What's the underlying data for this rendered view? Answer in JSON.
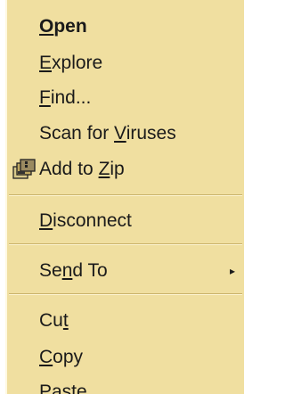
{
  "menu": {
    "open": {
      "pre": "",
      "acc": "O",
      "post": "pen"
    },
    "explore": {
      "pre": "",
      "acc": "E",
      "post": "xplore"
    },
    "find": {
      "pre": "",
      "acc": "F",
      "post": "ind..."
    },
    "scan": {
      "pre": "Scan for ",
      "acc": "V",
      "post": "iruses"
    },
    "add_zip": {
      "pre": "Add to ",
      "acc": "Z",
      "post": "ip",
      "icon": "zip-archive-icon"
    },
    "disconnect": {
      "pre": "",
      "acc": "D",
      "post": "isconnect"
    },
    "send_to": {
      "pre": "Se",
      "acc": "n",
      "post": "d To",
      "arrow": "▸"
    },
    "cut": {
      "pre": "Cu",
      "acc": "t",
      "post": ""
    },
    "copy": {
      "pre": "",
      "acc": "C",
      "post": "opy"
    },
    "paste": {
      "pre": "Paste",
      "acc": "",
      "post": ""
    }
  },
  "colors": {
    "menu_background": "#f0dfa0",
    "separator_dark": "#c9b26a",
    "separator_light": "#fff6d2",
    "text": "#1a1a1a"
  }
}
